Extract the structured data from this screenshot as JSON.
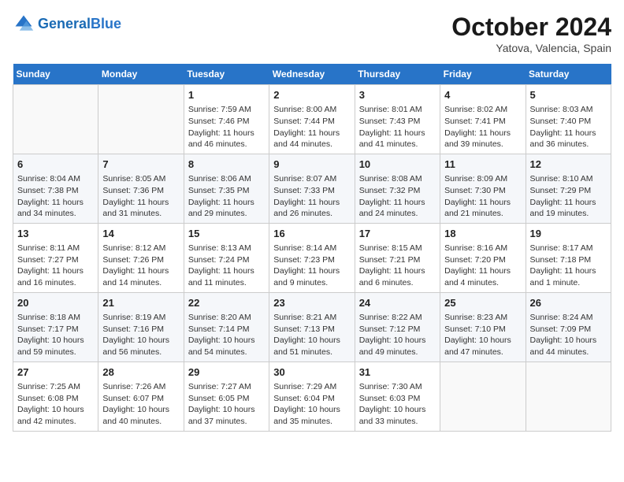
{
  "header": {
    "logo_general": "General",
    "logo_blue": "Blue",
    "month_title": "October 2024",
    "location": "Yatova, Valencia, Spain"
  },
  "days_of_week": [
    "Sunday",
    "Monday",
    "Tuesday",
    "Wednesday",
    "Thursday",
    "Friday",
    "Saturday"
  ],
  "weeks": [
    [
      {
        "day": "",
        "empty": true
      },
      {
        "day": "",
        "empty": true
      },
      {
        "day": "1",
        "sunrise": "Sunrise: 7:59 AM",
        "sunset": "Sunset: 7:46 PM",
        "daylight": "Daylight: 11 hours and 46 minutes."
      },
      {
        "day": "2",
        "sunrise": "Sunrise: 8:00 AM",
        "sunset": "Sunset: 7:44 PM",
        "daylight": "Daylight: 11 hours and 44 minutes."
      },
      {
        "day": "3",
        "sunrise": "Sunrise: 8:01 AM",
        "sunset": "Sunset: 7:43 PM",
        "daylight": "Daylight: 11 hours and 41 minutes."
      },
      {
        "day": "4",
        "sunrise": "Sunrise: 8:02 AM",
        "sunset": "Sunset: 7:41 PM",
        "daylight": "Daylight: 11 hours and 39 minutes."
      },
      {
        "day": "5",
        "sunrise": "Sunrise: 8:03 AM",
        "sunset": "Sunset: 7:40 PM",
        "daylight": "Daylight: 11 hours and 36 minutes."
      }
    ],
    [
      {
        "day": "6",
        "sunrise": "Sunrise: 8:04 AM",
        "sunset": "Sunset: 7:38 PM",
        "daylight": "Daylight: 11 hours and 34 minutes."
      },
      {
        "day": "7",
        "sunrise": "Sunrise: 8:05 AM",
        "sunset": "Sunset: 7:36 PM",
        "daylight": "Daylight: 11 hours and 31 minutes."
      },
      {
        "day": "8",
        "sunrise": "Sunrise: 8:06 AM",
        "sunset": "Sunset: 7:35 PM",
        "daylight": "Daylight: 11 hours and 29 minutes."
      },
      {
        "day": "9",
        "sunrise": "Sunrise: 8:07 AM",
        "sunset": "Sunset: 7:33 PM",
        "daylight": "Daylight: 11 hours and 26 minutes."
      },
      {
        "day": "10",
        "sunrise": "Sunrise: 8:08 AM",
        "sunset": "Sunset: 7:32 PM",
        "daylight": "Daylight: 11 hours and 24 minutes."
      },
      {
        "day": "11",
        "sunrise": "Sunrise: 8:09 AM",
        "sunset": "Sunset: 7:30 PM",
        "daylight": "Daylight: 11 hours and 21 minutes."
      },
      {
        "day": "12",
        "sunrise": "Sunrise: 8:10 AM",
        "sunset": "Sunset: 7:29 PM",
        "daylight": "Daylight: 11 hours and 19 minutes."
      }
    ],
    [
      {
        "day": "13",
        "sunrise": "Sunrise: 8:11 AM",
        "sunset": "Sunset: 7:27 PM",
        "daylight": "Daylight: 11 hours and 16 minutes."
      },
      {
        "day": "14",
        "sunrise": "Sunrise: 8:12 AM",
        "sunset": "Sunset: 7:26 PM",
        "daylight": "Daylight: 11 hours and 14 minutes."
      },
      {
        "day": "15",
        "sunrise": "Sunrise: 8:13 AM",
        "sunset": "Sunset: 7:24 PM",
        "daylight": "Daylight: 11 hours and 11 minutes."
      },
      {
        "day": "16",
        "sunrise": "Sunrise: 8:14 AM",
        "sunset": "Sunset: 7:23 PM",
        "daylight": "Daylight: 11 hours and 9 minutes."
      },
      {
        "day": "17",
        "sunrise": "Sunrise: 8:15 AM",
        "sunset": "Sunset: 7:21 PM",
        "daylight": "Daylight: 11 hours and 6 minutes."
      },
      {
        "day": "18",
        "sunrise": "Sunrise: 8:16 AM",
        "sunset": "Sunset: 7:20 PM",
        "daylight": "Daylight: 11 hours and 4 minutes."
      },
      {
        "day": "19",
        "sunrise": "Sunrise: 8:17 AM",
        "sunset": "Sunset: 7:18 PM",
        "daylight": "Daylight: 11 hours and 1 minute."
      }
    ],
    [
      {
        "day": "20",
        "sunrise": "Sunrise: 8:18 AM",
        "sunset": "Sunset: 7:17 PM",
        "daylight": "Daylight: 10 hours and 59 minutes."
      },
      {
        "day": "21",
        "sunrise": "Sunrise: 8:19 AM",
        "sunset": "Sunset: 7:16 PM",
        "daylight": "Daylight: 10 hours and 56 minutes."
      },
      {
        "day": "22",
        "sunrise": "Sunrise: 8:20 AM",
        "sunset": "Sunset: 7:14 PM",
        "daylight": "Daylight: 10 hours and 54 minutes."
      },
      {
        "day": "23",
        "sunrise": "Sunrise: 8:21 AM",
        "sunset": "Sunset: 7:13 PM",
        "daylight": "Daylight: 10 hours and 51 minutes."
      },
      {
        "day": "24",
        "sunrise": "Sunrise: 8:22 AM",
        "sunset": "Sunset: 7:12 PM",
        "daylight": "Daylight: 10 hours and 49 minutes."
      },
      {
        "day": "25",
        "sunrise": "Sunrise: 8:23 AM",
        "sunset": "Sunset: 7:10 PM",
        "daylight": "Daylight: 10 hours and 47 minutes."
      },
      {
        "day": "26",
        "sunrise": "Sunrise: 8:24 AM",
        "sunset": "Sunset: 7:09 PM",
        "daylight": "Daylight: 10 hours and 44 minutes."
      }
    ],
    [
      {
        "day": "27",
        "sunrise": "Sunrise: 7:25 AM",
        "sunset": "Sunset: 6:08 PM",
        "daylight": "Daylight: 10 hours and 42 minutes."
      },
      {
        "day": "28",
        "sunrise": "Sunrise: 7:26 AM",
        "sunset": "Sunset: 6:07 PM",
        "daylight": "Daylight: 10 hours and 40 minutes."
      },
      {
        "day": "29",
        "sunrise": "Sunrise: 7:27 AM",
        "sunset": "Sunset: 6:05 PM",
        "daylight": "Daylight: 10 hours and 37 minutes."
      },
      {
        "day": "30",
        "sunrise": "Sunrise: 7:29 AM",
        "sunset": "Sunset: 6:04 PM",
        "daylight": "Daylight: 10 hours and 35 minutes."
      },
      {
        "day": "31",
        "sunrise": "Sunrise: 7:30 AM",
        "sunset": "Sunset: 6:03 PM",
        "daylight": "Daylight: 10 hours and 33 minutes."
      },
      {
        "day": "",
        "empty": true
      },
      {
        "day": "",
        "empty": true
      }
    ]
  ]
}
